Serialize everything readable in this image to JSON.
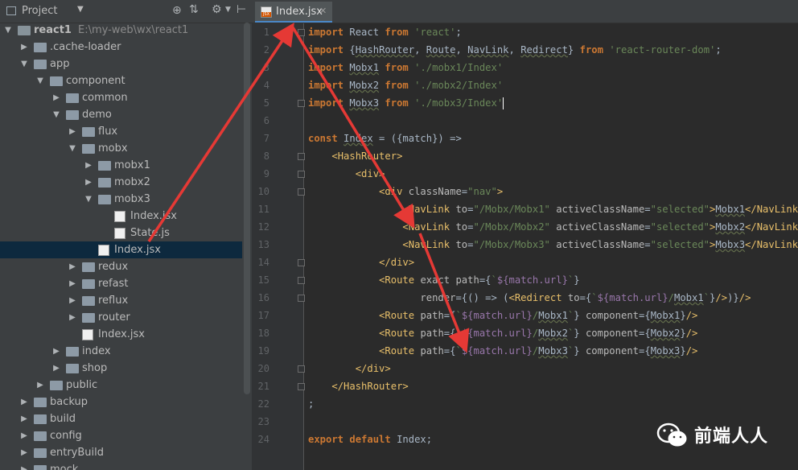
{
  "sidebar": {
    "header_label": "Project",
    "tree": [
      {
        "depth": 0,
        "arrow": "open",
        "icon": "folder",
        "label": "react1",
        "sub": "E:\\my-web\\wx\\react1",
        "bold": true
      },
      {
        "depth": 1,
        "arrow": "closed",
        "icon": "folder",
        "label": ".cache-loader"
      },
      {
        "depth": 1,
        "arrow": "open",
        "icon": "folder",
        "label": "app"
      },
      {
        "depth": 2,
        "arrow": "open",
        "icon": "folder",
        "label": "component"
      },
      {
        "depth": 3,
        "arrow": "closed",
        "icon": "folder",
        "label": "common"
      },
      {
        "depth": 3,
        "arrow": "open",
        "icon": "folder",
        "label": "demo"
      },
      {
        "depth": 4,
        "arrow": "closed",
        "icon": "folder",
        "label": "flux"
      },
      {
        "depth": 4,
        "arrow": "open",
        "icon": "folder",
        "label": "mobx"
      },
      {
        "depth": 5,
        "arrow": "closed",
        "icon": "folder",
        "label": "mobx1"
      },
      {
        "depth": 5,
        "arrow": "closed",
        "icon": "folder",
        "label": "mobx2"
      },
      {
        "depth": 5,
        "arrow": "open",
        "icon": "folder",
        "label": "mobx3"
      },
      {
        "depth": 6,
        "arrow": "none",
        "icon": "jsx",
        "label": "Index.jsx"
      },
      {
        "depth": 6,
        "arrow": "none",
        "icon": "js",
        "label": "State.js"
      },
      {
        "depth": 5,
        "arrow": "none",
        "icon": "jsx",
        "label": "Index.jsx",
        "selected": true
      },
      {
        "depth": 4,
        "arrow": "closed",
        "icon": "folder",
        "label": "redux"
      },
      {
        "depth": 4,
        "arrow": "closed",
        "icon": "folder",
        "label": "refast"
      },
      {
        "depth": 4,
        "arrow": "closed",
        "icon": "folder",
        "label": "reflux"
      },
      {
        "depth": 4,
        "arrow": "closed",
        "icon": "folder",
        "label": "router"
      },
      {
        "depth": 4,
        "arrow": "none",
        "icon": "jsx",
        "label": "Index.jsx"
      },
      {
        "depth": 3,
        "arrow": "closed",
        "icon": "folder",
        "label": "index"
      },
      {
        "depth": 3,
        "arrow": "closed",
        "icon": "folder",
        "label": "shop"
      },
      {
        "depth": 2,
        "arrow": "closed",
        "icon": "folder",
        "label": "public"
      },
      {
        "depth": 1,
        "arrow": "closed",
        "icon": "folder",
        "label": "backup"
      },
      {
        "depth": 1,
        "arrow": "closed",
        "icon": "folder",
        "label": "build"
      },
      {
        "depth": 1,
        "arrow": "closed",
        "icon": "folder",
        "label": "config"
      },
      {
        "depth": 1,
        "arrow": "closed",
        "icon": "folder",
        "label": "entryBuild"
      },
      {
        "depth": 1,
        "arrow": "closed",
        "icon": "folder",
        "label": "mock"
      }
    ]
  },
  "editor": {
    "tab_label": "Index.jsx",
    "file_icon_text": "JSX",
    "lines": [
      [
        [
          "kw",
          "import"
        ],
        [
          "p",
          " React "
        ],
        [
          "kw",
          "from"
        ],
        [
          "p",
          " "
        ],
        [
          "str",
          "'react'"
        ],
        [
          "p",
          ";"
        ]
      ],
      [
        [
          "kw",
          "import"
        ],
        [
          "p",
          " {"
        ],
        [
          "u",
          "HashRouter"
        ],
        [
          "p",
          ", "
        ],
        [
          "u",
          "Route"
        ],
        [
          "p",
          ", "
        ],
        [
          "u",
          "NavLink"
        ],
        [
          "p",
          ", "
        ],
        [
          "u",
          "Redirect"
        ],
        [
          "p",
          "} "
        ],
        [
          "kw",
          "from"
        ],
        [
          "p",
          " "
        ],
        [
          "str",
          "'react-router-dom'"
        ],
        [
          "p",
          ";"
        ]
      ],
      [
        [
          "kw",
          "import"
        ],
        [
          "p",
          " "
        ],
        [
          "u",
          "Mobx1"
        ],
        [
          "p",
          " "
        ],
        [
          "kw",
          "from"
        ],
        [
          "p",
          " "
        ],
        [
          "str",
          "'./mobx1/Index'"
        ]
      ],
      [
        [
          "kw",
          "import"
        ],
        [
          "p",
          " "
        ],
        [
          "u",
          "Mobx2"
        ],
        [
          "p",
          " "
        ],
        [
          "kw",
          "from"
        ],
        [
          "p",
          " "
        ],
        [
          "str",
          "'./mobx2/Index'"
        ]
      ],
      [
        [
          "kw",
          "import"
        ],
        [
          "p",
          " "
        ],
        [
          "u",
          "Mobx3"
        ],
        [
          "p",
          " "
        ],
        [
          "kw",
          "from"
        ],
        [
          "p",
          " "
        ],
        [
          "str",
          "'./mobx3/Index'"
        ],
        [
          "caret",
          ""
        ]
      ],
      [],
      [
        [
          "kw",
          "const"
        ],
        [
          "p",
          " "
        ],
        [
          "u",
          "Index"
        ],
        [
          "p",
          " = ({"
        ],
        [
          "p",
          "match"
        ],
        [
          "p",
          "}) =>"
        ]
      ],
      [
        [
          "p",
          "    "
        ],
        [
          "tag",
          "<HashRouter>"
        ]
      ],
      [
        [
          "p",
          "        "
        ],
        [
          "tag",
          "<div>"
        ]
      ],
      [
        [
          "p",
          "            "
        ],
        [
          "tag",
          "<div "
        ],
        [
          "attr",
          "className"
        ],
        [
          "p",
          "="
        ],
        [
          "str",
          "\"nav\""
        ],
        [
          "tag",
          ">"
        ]
      ],
      [
        [
          "p",
          "                "
        ],
        [
          "tag",
          "<NavLink "
        ],
        [
          "attr",
          "to"
        ],
        [
          "p",
          "="
        ],
        [
          "str",
          "\"/Mobx/Mobx1\""
        ],
        [
          "p",
          " "
        ],
        [
          "attr",
          "activeClassName"
        ],
        [
          "p",
          "="
        ],
        [
          "str",
          "\"selected\""
        ],
        [
          "tag",
          ">"
        ],
        [
          "u",
          "Mobx1"
        ],
        [
          "tag",
          "</NavLink>"
        ]
      ],
      [
        [
          "p",
          "                "
        ],
        [
          "tag",
          "<NavLink "
        ],
        [
          "attr",
          "to"
        ],
        [
          "p",
          "="
        ],
        [
          "str",
          "\"/Mobx/Mobx2\""
        ],
        [
          "p",
          " "
        ],
        [
          "attr",
          "activeClassName"
        ],
        [
          "p",
          "="
        ],
        [
          "str",
          "\"selected\""
        ],
        [
          "tag",
          ">"
        ],
        [
          "u",
          "Mobx2"
        ],
        [
          "tag",
          "</NavLink>"
        ]
      ],
      [
        [
          "p",
          "                "
        ],
        [
          "tag",
          "<NavLink "
        ],
        [
          "attr",
          "to"
        ],
        [
          "p",
          "="
        ],
        [
          "str",
          "\"/Mobx/Mobx3\""
        ],
        [
          "p",
          " "
        ],
        [
          "attr",
          "activeClassName"
        ],
        [
          "p",
          "="
        ],
        [
          "str",
          "\"selected\""
        ],
        [
          "tag",
          ">"
        ],
        [
          "u",
          "Mobx3"
        ],
        [
          "tag",
          "</NavLink>"
        ]
      ],
      [
        [
          "p",
          "            "
        ],
        [
          "tag",
          "</div>"
        ]
      ],
      [
        [
          "p",
          "            "
        ],
        [
          "tag",
          "<Route "
        ],
        [
          "attr",
          "exact"
        ],
        [
          "p",
          " "
        ],
        [
          "attr",
          "path"
        ],
        [
          "p",
          "={"
        ],
        [
          "str",
          "`"
        ],
        [
          "var",
          "${match.url}"
        ],
        [
          "str",
          "`"
        ],
        [
          "p",
          "}"
        ]
      ],
      [
        [
          "p",
          "                   "
        ],
        [
          "attr",
          "render"
        ],
        [
          "p",
          "={() => ("
        ],
        [
          "tag",
          "<Redirect "
        ],
        [
          "attr",
          "to"
        ],
        [
          "p",
          "={"
        ],
        [
          "str",
          "`"
        ],
        [
          "var",
          "${match.url}"
        ],
        [
          "str",
          "/"
        ],
        [
          "u",
          "Mobx1"
        ],
        [
          "str",
          "`"
        ],
        [
          "p",
          "}"
        ],
        [
          "tag",
          "/>"
        ],
        [
          "p",
          ")}"
        ],
        [
          "tag",
          "/>"
        ]
      ],
      [
        [
          "p",
          "            "
        ],
        [
          "tag",
          "<Route "
        ],
        [
          "attr",
          "path"
        ],
        [
          "p",
          "={"
        ],
        [
          "str",
          "`"
        ],
        [
          "var",
          "${match.url}"
        ],
        [
          "str",
          "/"
        ],
        [
          "u",
          "Mobx1"
        ],
        [
          "str",
          "`"
        ],
        [
          "p",
          "} "
        ],
        [
          "attr",
          "component"
        ],
        [
          "p",
          "={"
        ],
        [
          "u",
          "Mobx1"
        ],
        [
          "p",
          "}"
        ],
        [
          "tag",
          "/>"
        ]
      ],
      [
        [
          "p",
          "            "
        ],
        [
          "tag",
          "<Route "
        ],
        [
          "attr",
          "path"
        ],
        [
          "p",
          "={"
        ],
        [
          "str",
          "`"
        ],
        [
          "var",
          "${match.url}"
        ],
        [
          "str",
          "/"
        ],
        [
          "u",
          "Mobx2"
        ],
        [
          "str",
          "`"
        ],
        [
          "p",
          "} "
        ],
        [
          "attr",
          "component"
        ],
        [
          "p",
          "={"
        ],
        [
          "u",
          "Mobx2"
        ],
        [
          "p",
          "}"
        ],
        [
          "tag",
          "/>"
        ]
      ],
      [
        [
          "p",
          "            "
        ],
        [
          "tag",
          "<Route "
        ],
        [
          "attr",
          "path"
        ],
        [
          "p",
          "={"
        ],
        [
          "str",
          "`"
        ],
        [
          "var",
          "${match.url}"
        ],
        [
          "str",
          "/"
        ],
        [
          "u",
          "Mobx3"
        ],
        [
          "str",
          "`"
        ],
        [
          "p",
          "} "
        ],
        [
          "attr",
          "component"
        ],
        [
          "p",
          "={"
        ],
        [
          "u",
          "Mobx3"
        ],
        [
          "p",
          "}"
        ],
        [
          "tag",
          "/>"
        ]
      ],
      [
        [
          "p",
          "        "
        ],
        [
          "tag",
          "</div>"
        ]
      ],
      [
        [
          "p",
          "    "
        ],
        [
          "tag",
          "</HashRouter>"
        ]
      ],
      [
        [
          "p",
          ";"
        ]
      ],
      [],
      [
        [
          "kw",
          "export"
        ],
        [
          "p",
          " "
        ],
        [
          "kw",
          "default"
        ],
        [
          "p",
          " Index;"
        ]
      ]
    ]
  },
  "watermark": {
    "text": "前端人人"
  },
  "colors": {
    "arrow": "#e53935",
    "selected_row": "#0d293e",
    "tab_underline": "#4a88c7"
  }
}
